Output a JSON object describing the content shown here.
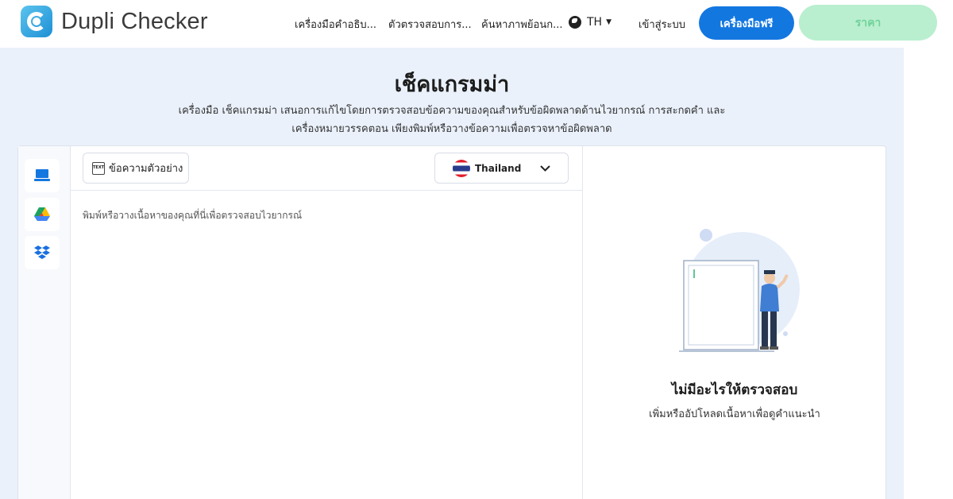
{
  "header": {
    "logo_text": "Dupli Checker",
    "nav": [
      {
        "label": "เครื่องมือคำอธิบ..."
      },
      {
        "label": "ตัวตรวจสอบการ..."
      },
      {
        "label": "ค้นหาภาพย้อนก..."
      }
    ],
    "language": "TH",
    "login_label": "เข้าสู่ระบบ",
    "free_tools_label": "เครื่องมือฟรี",
    "pricing_label": "ราคา"
  },
  "page": {
    "title": "เช็คแกรมม่า",
    "description_line1": "เครื่องมือ เช็คแกรมม่า เสนอการแก้ไขโดยการตรวจสอบข้อความของคุณสำหรับข้อผิดพลาดด้านไวยากรณ์ การสะกดคำ และ",
    "description_line2": "เครื่องหมายวรรคตอน เพียงพิมพ์หรือวางข้อความเพื่อตรวจหาข้อผิดพลาด"
  },
  "editor": {
    "sample_button_label": "ข้อความตัวอย่าง",
    "sample_icon_text": "TEXT",
    "country_selected": "Thailand",
    "placeholder": "พิมพ์หรือวางเนื้อหาของคุณที่นี่เพื่อตรวจสอบไวยากรณ์"
  },
  "sidebar": {
    "sources": [
      {
        "icon": "laptop-icon"
      },
      {
        "icon": "google-drive-icon"
      },
      {
        "icon": "dropbox-icon"
      }
    ]
  },
  "results": {
    "empty_title": "ไม่มีอะไรให้ตรวจสอบ",
    "empty_subtitle": "เพิ่มหรืออัปโหลดเนื้อหาเพื่อดูคำแนะนำ"
  },
  "colors": {
    "primary": "#1377e0",
    "pricing_bg": "#b9efcf",
    "page_bg": "#eaf1fb"
  }
}
